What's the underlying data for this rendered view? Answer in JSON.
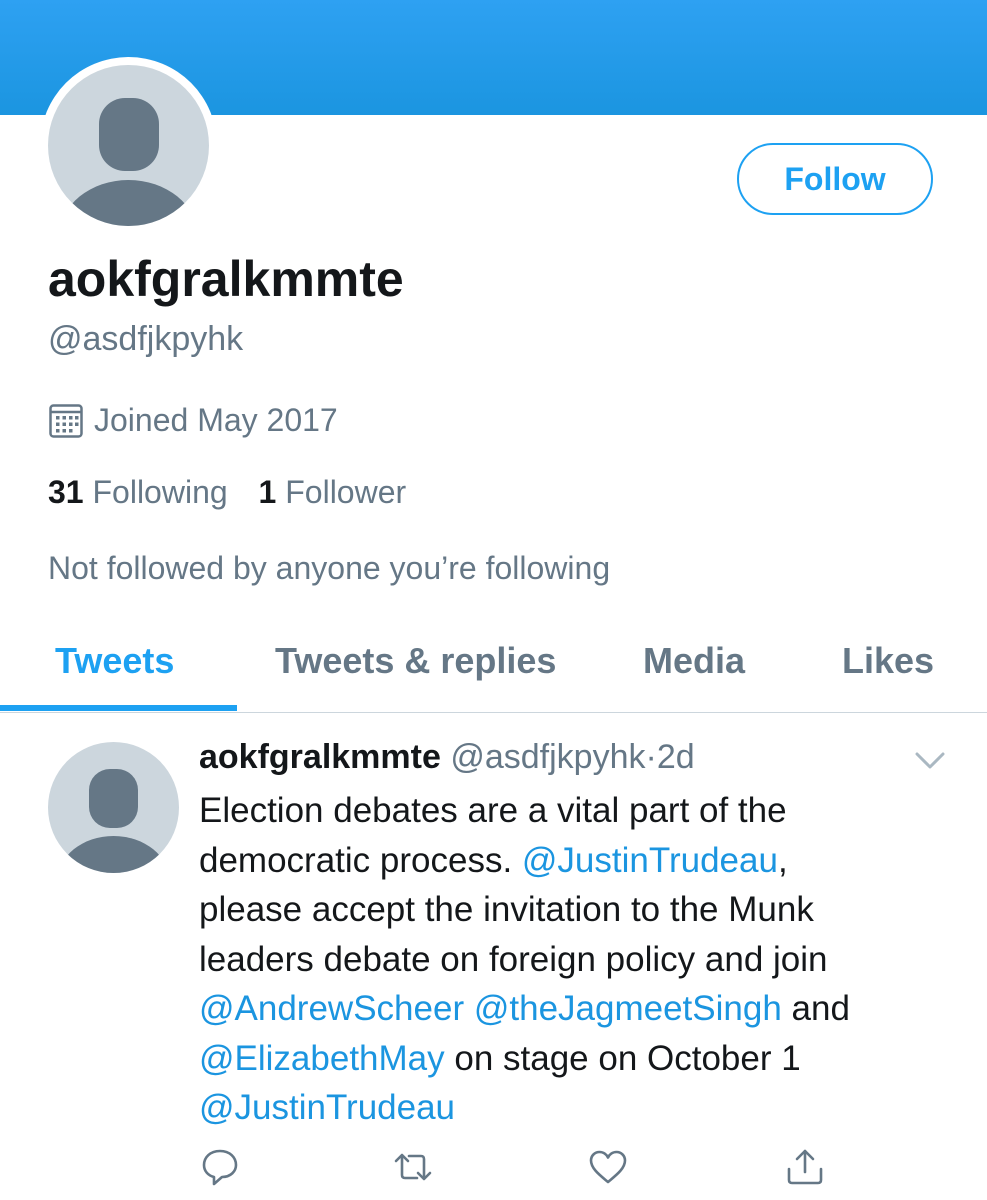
{
  "profile": {
    "display_name": "aokfgralkmmte",
    "handle": "@asdfjkpyhk",
    "joined": "Joined May 2017",
    "following_count": "31",
    "following_label": "Following",
    "followers_count": "1",
    "followers_label": "Follower",
    "not_followed_text": "Not followed by anyone you’re following",
    "follow_button": "Follow"
  },
  "tabs": [
    {
      "label": "Tweets",
      "active": true
    },
    {
      "label": "Tweets & replies",
      "active": false
    },
    {
      "label": "Media",
      "active": false
    },
    {
      "label": "Likes",
      "active": false
    }
  ],
  "tweet": {
    "name": "aokfgralkmmte",
    "handle": "@asdfjkpyhk",
    "separator": "·",
    "time": "2d",
    "text": {
      "p1": "Election debates are a vital part of the\ndemocratic process. ",
      "m1": "@JustinTrudeau",
      "p2": ",\nplease accept the invitation to the Munk\nleaders debate on foreign policy and join\n",
      "m2": "@AndrewScheer",
      "p3": " ",
      "m3": "@theJagmeetSingh",
      "p4": " and\n",
      "m4": "@ElizabethMay",
      "p5": " on stage on October 1\n",
      "m5": "@JustinTrudeau"
    }
  },
  "icons": {
    "calendar": "calendar-icon",
    "reply": "reply-icon",
    "retweet": "retweet-icon",
    "like": "heart-icon",
    "share": "share-icon",
    "caret": "chevron-down-icon"
  },
  "colors": {
    "accent": "#1da1f2",
    "text_primary": "#14171a",
    "text_secondary": "#657786",
    "avatar_bg": "#ccd6dd",
    "avatar_fg": "#657786"
  }
}
